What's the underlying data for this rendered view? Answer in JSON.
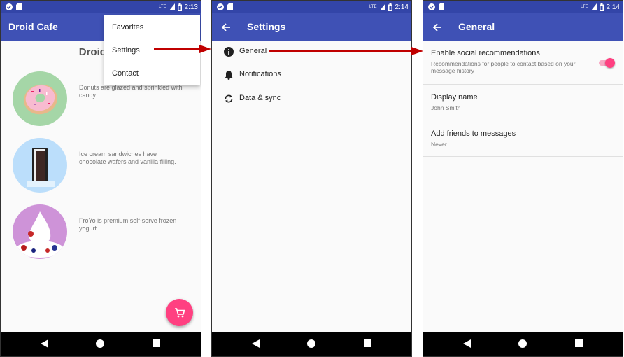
{
  "screen1": {
    "status_time": "2:13",
    "network_label": "LTE",
    "app_title": "Droid Cafe",
    "heading": "Droid De",
    "menu": [
      "Favorites",
      "Settings",
      "Contact"
    ],
    "desserts": [
      {
        "text": "Donuts are glazed and sprinkled with candy.",
        "image": "donut"
      },
      {
        "text": "Ice cream sandwiches have chocolate wafers and vanilla filling.",
        "image": "ice-cream-sandwich"
      },
      {
        "text": "FroYo is premium self-serve frozen yogurt.",
        "image": "froyo"
      }
    ],
    "fab_icon": "cart-icon"
  },
  "screen2": {
    "status_time": "2:14",
    "network_label": "LTE",
    "title": "Settings",
    "headers": [
      {
        "label": "General",
        "icon": "info-icon"
      },
      {
        "label": "Notifications",
        "icon": "bell-icon"
      },
      {
        "label": "Data & sync",
        "icon": "sync-icon"
      }
    ]
  },
  "screen3": {
    "status_time": "2:14",
    "network_label": "LTE",
    "title": "General",
    "prefs": [
      {
        "title": "Enable social recommendations",
        "summary": "Recommendations for people to contact based on your message history",
        "switch_on": true
      },
      {
        "title": "Display name",
        "summary": "John Smith"
      },
      {
        "title": "Add friends to messages",
        "summary": "Never"
      }
    ]
  },
  "colors": {
    "primary": "#3f51b5",
    "primary_dark": "#3345a8",
    "accent": "#ff4081",
    "arrow": "#c00000"
  }
}
